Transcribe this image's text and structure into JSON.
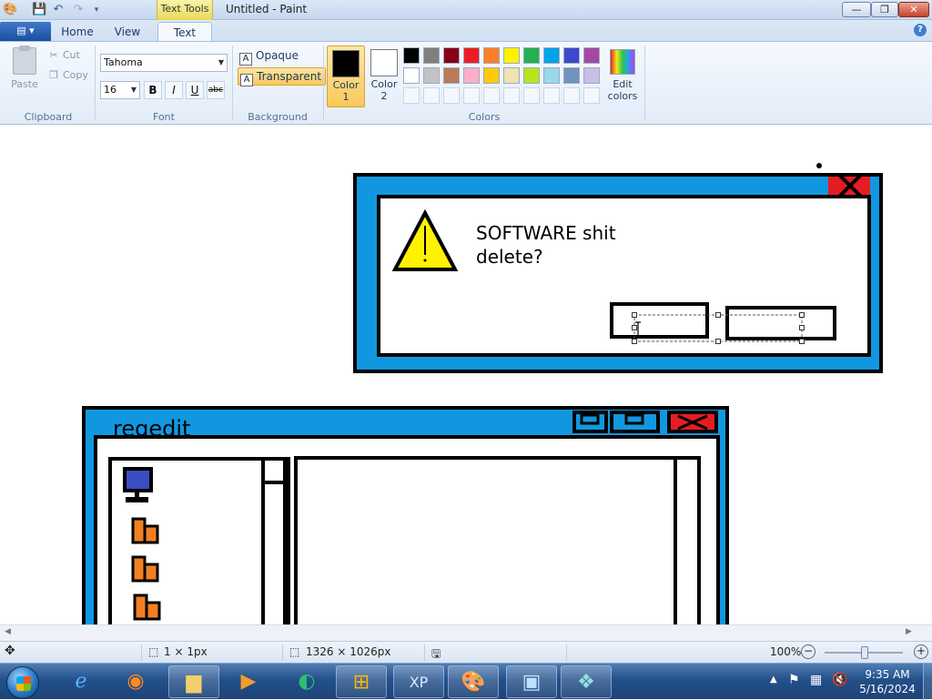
{
  "window": {
    "title": "Untitled - Paint",
    "context_tab": "Text Tools",
    "minimize_glyph": "—",
    "maximize_glyph": "❐",
    "close_glyph": "✕"
  },
  "ribbon_tabs": {
    "app_menu_glyph": "▤ ▾",
    "home": "Home",
    "view": "View",
    "text": "Text",
    "help_glyph": "?"
  },
  "clipboard": {
    "paste": "Paste",
    "cut": "Cut",
    "copy": "Copy",
    "group": "Clipboard"
  },
  "font": {
    "family": "Tahoma",
    "size": "16",
    "bold": "B",
    "italic": "I",
    "underline": "U",
    "strike": "abc",
    "group": "Font"
  },
  "background": {
    "opaque": "Opaque",
    "transparent": "Transparent",
    "group": "Background",
    "glyph": "A"
  },
  "colors": {
    "color1_label": "Color\n1",
    "color1_line1": "Color",
    "color1_line2": "1",
    "color2_line1": "Color",
    "color2_line2": "2",
    "color1_value": "#000000",
    "color2_value": "#ffffff",
    "edit_line1": "Edit",
    "edit_line2": "colors",
    "group": "Colors",
    "palette_row1": [
      "#000000",
      "#7f7f7f",
      "#880015",
      "#ed1c24",
      "#ff7f27",
      "#fff200",
      "#22b14c",
      "#00a2e8",
      "#3f48cc",
      "#a349a4"
    ],
    "palette_row2": [
      "#ffffff",
      "#c3c3c3",
      "#b97a57",
      "#ffaec9",
      "#ffc90e",
      "#efe4b0",
      "#b5e61d",
      "#99d9ea",
      "#7092be",
      "#c8bfe7"
    ]
  },
  "canvas": {
    "dialog_message_line1": "SOFTWARE shit",
    "dialog_message_line2": "delete?",
    "regedit_title": "regedit",
    "dialog_color": "#1197e0",
    "close_red": "#e51c23",
    "warning_yellow": "#fff200",
    "folder_orange": "#f27f22",
    "computer_blue": "#3b4dc4"
  },
  "status": {
    "selection_size": "1 × 1px",
    "image_size": "1326 × 1026px",
    "zoom": "100%"
  },
  "taskbar": {
    "time": "9:35 AM",
    "date": "5/16/2024",
    "items": [
      "internet-explorer",
      "firefox",
      "file-explorer",
      "media-player",
      "app-green",
      "windows-update",
      "xp-mode",
      "paint",
      "network-settings",
      "package"
    ]
  }
}
